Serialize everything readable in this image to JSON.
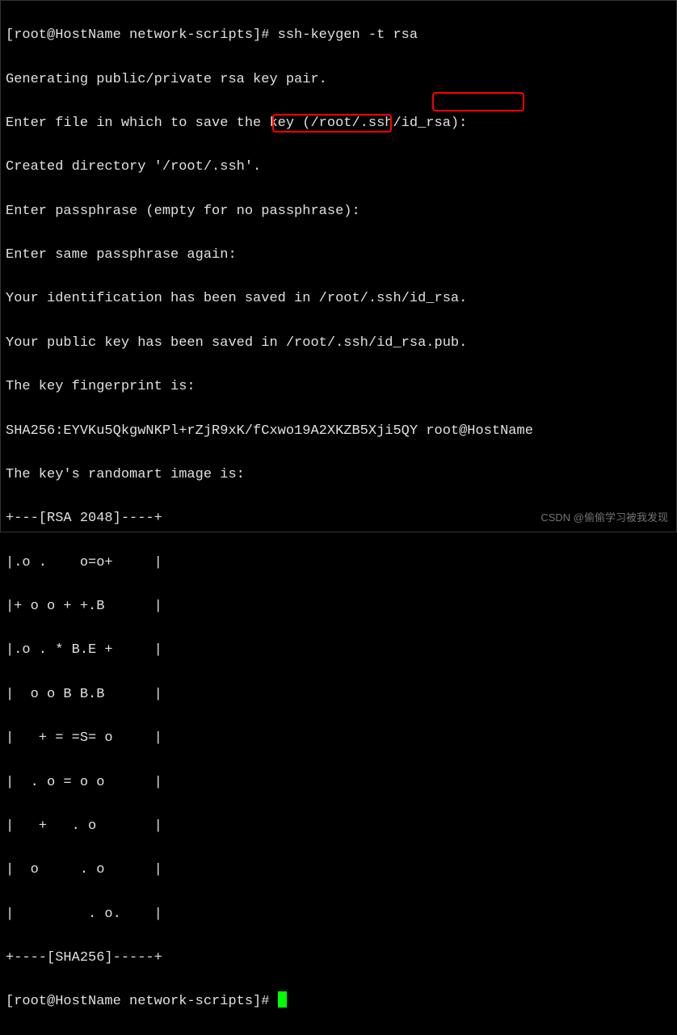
{
  "terminal": {
    "lines": [
      "[root@HostName network-scripts]# ssh-keygen -t rsa",
      "Generating public/private rsa key pair.",
      "Enter file in which to save the key (/root/.ssh/id_rsa):",
      "Created directory '/root/.ssh'.",
      "Enter passphrase (empty for no passphrase):",
      "Enter same passphrase again:",
      "Your identification has been saved in /root/.ssh/id_rsa.",
      "Your public key has been saved in /root/.ssh/id_rsa.pub.",
      "The key fingerprint is:",
      "SHA256:EYVKu5QkgwNKPl+rZjR9xK/fCxwo19A2XKZB5Xji5QY root@HostName",
      "The key's randomart image is:",
      "+---[RSA 2048]----+",
      "|.o .    o=o+     |",
      "|+ o o + +.B      |",
      "|.o . * B.E +     |",
      "|  o o B B.B      |",
      "|   + = =S= o     |",
      "|  . o = o o      |",
      "|   +   . o       |",
      "|  o     . o      |",
      "|         . o.    |",
      "+----[SHA256]-----+",
      "[root@HostName network-scripts]# "
    ]
  },
  "watermark": "CSDN @偷偷学习被我发现"
}
